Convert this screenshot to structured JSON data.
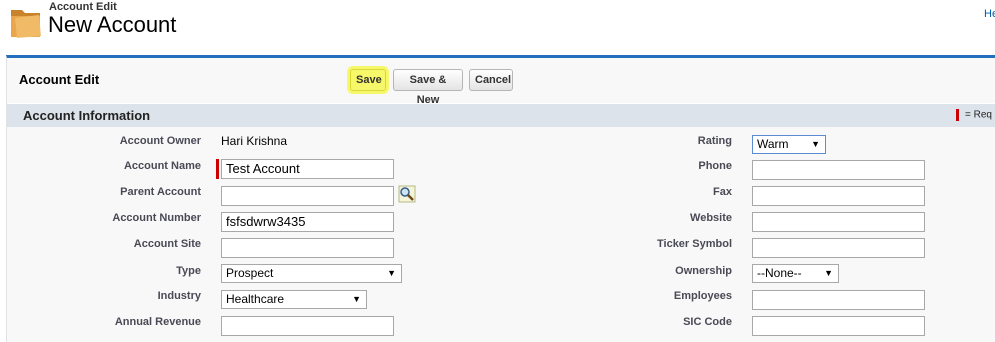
{
  "header": {
    "subtitle": "Account Edit",
    "title": "New Account",
    "help_link": "He"
  },
  "panel": {
    "title": "Account Edit",
    "buttons": {
      "save": "Save",
      "save_new": "Save & New",
      "cancel": "Cancel"
    }
  },
  "section": {
    "title": "Account Information",
    "required_legend": "= Req"
  },
  "left_fields": {
    "account_owner": {
      "label": "Account Owner",
      "value": "Hari Krishna"
    },
    "account_name": {
      "label": "Account Name",
      "value": "Test Account"
    },
    "parent_account": {
      "label": "Parent Account",
      "value": ""
    },
    "account_number": {
      "label": "Account Number",
      "value": "fsfsdwrw3435"
    },
    "account_site": {
      "label": "Account Site",
      "value": ""
    },
    "type": {
      "label": "Type",
      "value": "Prospect"
    },
    "industry": {
      "label": "Industry",
      "value": "Healthcare"
    },
    "annual_revenue": {
      "label": "Annual Revenue",
      "value": ""
    }
  },
  "right_fields": {
    "rating": {
      "label": "Rating",
      "value": "Warm"
    },
    "phone": {
      "label": "Phone",
      "value": ""
    },
    "fax": {
      "label": "Fax",
      "value": ""
    },
    "website": {
      "label": "Website",
      "value": ""
    },
    "ticker_symbol": {
      "label": "Ticker Symbol",
      "value": ""
    },
    "ownership": {
      "label": "Ownership",
      "value": "--None--"
    },
    "employees": {
      "label": "Employees",
      "value": ""
    },
    "sic_code": {
      "label": "SIC Code",
      "value": ""
    }
  },
  "icons": {
    "folder": "folder-icon",
    "lookup": "lookup-icon",
    "dropdown": "chevron-down-icon"
  },
  "colors": {
    "accent": "#236fbd",
    "required": "#cc0000",
    "highlight": "#f7f76a",
    "section_bar": "#dde3ea"
  }
}
